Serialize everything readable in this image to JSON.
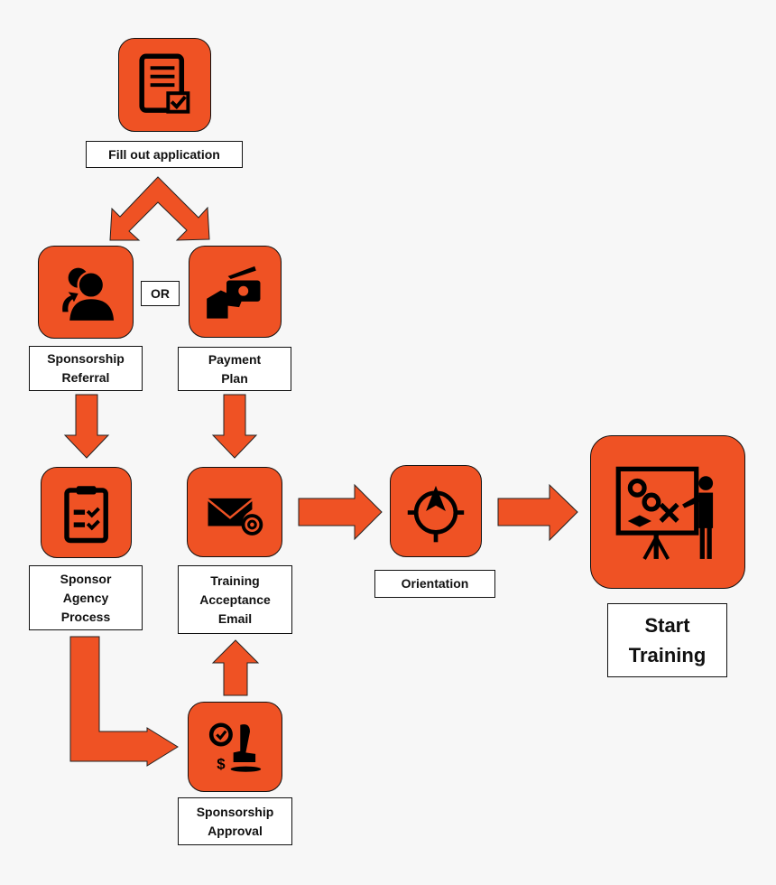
{
  "colors": {
    "accent": "#ef5224",
    "outline": "#111111",
    "background": "#f7f7f7"
  },
  "steps": {
    "fill_application": {
      "label": "Fill out application",
      "icon": "application-form-icon"
    },
    "or": "OR",
    "sponsorship_referral": {
      "label": "Sponsorship\nReferral",
      "icon": "referral-people-icon"
    },
    "payment_plan": {
      "label": "Payment\nPlan",
      "icon": "payment-hand-icon"
    },
    "sponsor_agency_process": {
      "label": "Sponsor\nAgency\nProcess",
      "icon": "clipboard-checklist-icon"
    },
    "training_acceptance_email": {
      "label": "Training\nAcceptance\nEmail",
      "icon": "email-at-icon"
    },
    "sponsorship_approval": {
      "label": "Sponsorship\nApproval",
      "icon": "stamp-approval-icon"
    },
    "orientation": {
      "label": "Orientation",
      "icon": "compass-target-icon"
    },
    "start_training": {
      "label": "Start\nTraining",
      "icon": "trainer-presentation-icon"
    }
  }
}
